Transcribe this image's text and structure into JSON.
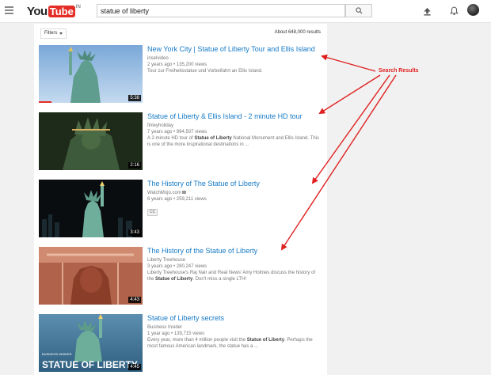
{
  "header": {
    "logo_you": "You",
    "logo_tube": "Tube",
    "logo_region": "IN",
    "search_query": "statue of liberty"
  },
  "toolbar": {
    "filters_label": "Filters",
    "results_count": "About 648,000 results"
  },
  "results": [
    {
      "title": "New York City | Statue of Liberty Tour and Ellis Island",
      "channel": "inselvideo",
      "meta": "2 years ago • 135,200 views",
      "desc_parts": [
        "Tour zur Freiheitsstatue und Vorbeifahrt an Ellis Island."
      ],
      "duration": "5:38",
      "watched": 0.12
    },
    {
      "title": "Statue of Liberty & Ellis Island - 2 minute HD tour",
      "channel": "finleyholiday",
      "meta": "7 years ago • 994,507 views",
      "desc_parts": [
        "A 2-minute HD tour of ",
        "Statue of Liberty",
        " National Monument and Ellis Island. This is one of the more inspirational destinations in ..."
      ],
      "duration": "2:16"
    },
    {
      "title": "The History of The Statue of Liberty",
      "channel": "WatchMojo.com",
      "meta": "6 years ago • 259,211 views",
      "badge": "CC",
      "duration": "3:43"
    },
    {
      "title": "The History of the Statue of Liberty",
      "channel": "Liberty Treehouse",
      "meta": "3 years ago • 280,247 views",
      "desc_parts": [
        "Liberty Treehouse's Raj Nair and Real News' Amy Holmes discuss the history of the ",
        "Statue of Liberty",
        ". Don't miss a single LTH!"
      ],
      "duration": "4:43"
    },
    {
      "title": "Statue of Liberty secrets",
      "channel": "Business Insider",
      "meta": "1 year ago • 139,715 views",
      "desc_parts": [
        "Every year, more than 4 million people visit the ",
        "Statue of Liberty",
        ". Perhaps the most famous American landmark, the statue has a ..."
      ],
      "duration": "4:45",
      "thumb_text_small": "BUSINESS INSIDER",
      "thumb_text": "STATUE OF LIBERTY"
    }
  ],
  "annotation": {
    "label": "Search Results",
    "color": "#e02020"
  }
}
